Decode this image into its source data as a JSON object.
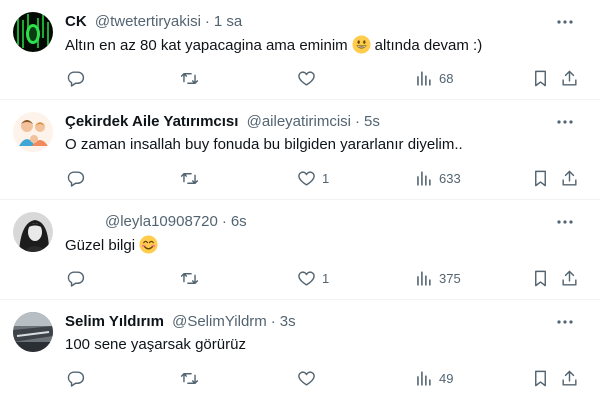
{
  "icons": {
    "reply": "reply-icon",
    "retweet": "retweet-icon",
    "like": "heart-icon",
    "views": "views-chart-icon",
    "bookmark": "bookmark-icon",
    "share": "share-icon",
    "more": "more-icon"
  },
  "colors": {
    "text": "#0f1419",
    "secondary": "#536471",
    "divider": "#eff3f4"
  },
  "replies": [
    {
      "name": "CK",
      "handle": "@twetertiryakisi",
      "dot": "·",
      "time": "1 sa",
      "text_before": "Altın en az 80 kat yapacagina ama eminim",
      "text_after": "altında devam :)",
      "likes": "",
      "views": "68"
    },
    {
      "name": "Çekirdek Aile Yatırımcısı",
      "handle": "@aileyatirimcisi",
      "dot": "·",
      "time": "5s",
      "text_before": "O zaman insallah buy fonuda bu bilgiden yararlanır diyelim..",
      "text_after": "",
      "likes": "1",
      "views": "633"
    },
    {
      "name": "",
      "handle": "@leyla10908720",
      "dot": "·",
      "time": "6s",
      "text_before": "Güzel bilgi",
      "text_after": "",
      "likes": "1",
      "views": "375"
    },
    {
      "name": "Selim Yıldırım",
      "handle": "@SelimYildrm",
      "dot": "·",
      "time": "3s",
      "text_before": "100 sene yaşarsak görürüz",
      "text_after": "",
      "likes": "",
      "views": "49"
    }
  ]
}
